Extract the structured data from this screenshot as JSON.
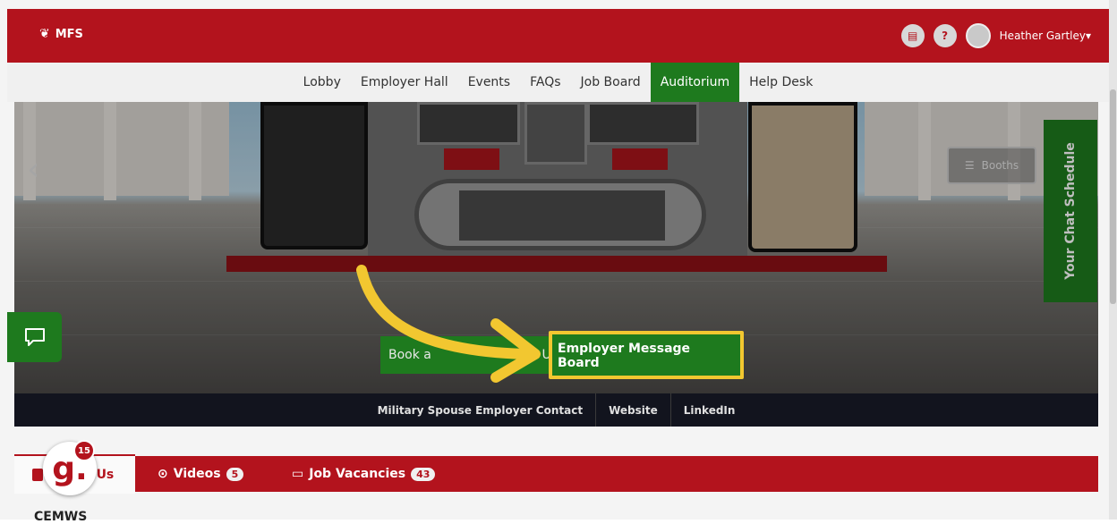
{
  "header": {
    "logo_text": "MFS",
    "help_label": "?",
    "user_name": "Heather Gartley",
    "user_menu_caret": "▾"
  },
  "nav": {
    "items": [
      {
        "label": "Lobby",
        "active": false
      },
      {
        "label": "Employer Hall",
        "active": false
      },
      {
        "label": "Events",
        "active": false
      },
      {
        "label": "FAQs",
        "active": false
      },
      {
        "label": "Job Board",
        "active": false
      },
      {
        "label": "Auditorium",
        "active": true
      },
      {
        "label": "Help Desk",
        "active": false
      }
    ]
  },
  "hero": {
    "booths_label": "Booths",
    "chat_schedule_label": "Your Chat Schedule",
    "book_button_label": "Book a",
    "book_button_tail": "Us",
    "employer_message_board_label": "Employer Message Board"
  },
  "contact_bar": {
    "items": [
      "Military Spouse Employer Contact",
      "Website",
      "LinkedIn"
    ]
  },
  "tabs": {
    "about_label": "t Us",
    "videos_label": "Videos",
    "videos_count": "5",
    "jobs_label": "Job Vacancies",
    "jobs_count": "43"
  },
  "widget": {
    "g_letter": "g.",
    "notification_count": "15"
  },
  "section": {
    "title": "CEMWS"
  },
  "colors": {
    "brand_red": "#b3131d",
    "active_green": "#1e7a1e",
    "highlight_yellow": "#f2c730"
  }
}
